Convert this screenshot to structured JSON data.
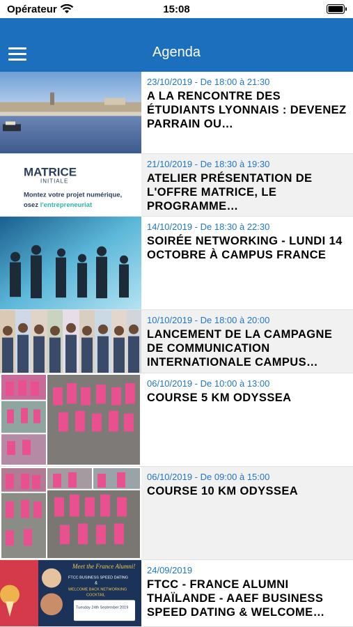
{
  "status_bar": {
    "carrier": "Opérateur",
    "time": "15:08"
  },
  "navbar": {
    "title": "Agenda",
    "menu_icon": "hamburger-icon"
  },
  "thumb_texts": {
    "matrice_logo": "MATRICE",
    "matrice_sub": "INITIALE",
    "matrice_line1": "Montez votre projet numérique,",
    "matrice_line2": "osez",
    "matrice_line2_accent": "l'entrepreneuriat",
    "ftcc_header": "Meet the France Alumni!",
    "ftcc_line1": "FTCC BUSINESS SPEED DATING",
    "ftcc_line2": "&",
    "ftcc_line3": "WELCOME BACK NETWORKING",
    "ftcc_line4": "COCKTAIL",
    "ftcc_date": "Tuesday 24th September 2019"
  },
  "events": [
    {
      "date": "23/10/2019 - De 18:00 à 21:30",
      "title": "A LA RENCONTRE DES ÉTUDIANTS LYONNAIS : DEVENEZ PARRAIN OU…"
    },
    {
      "date": "21/10/2019 - De 18:30 à 19:30",
      "title": "ATELIER PRÉSENTATION DE L'OFFRE MATRICE, LE PROGRAMME…"
    },
    {
      "date": "14/10/2019 - De 18:30 à 22:30",
      "title": "SOIRÉE NETWORKING - LUNDI 14 OCTOBRE À CAMPUS FRANCE"
    },
    {
      "date": "10/10/2019 - De 18:00 à 20:00",
      "title": "LANCEMENT DE LA CAMPAGNE DE COMMUNICATION INTERNATIONALE CAMPUS…"
    },
    {
      "date": "06/10/2019 - De 10:00 à 13:00",
      "title": "COURSE 5 KM ODYSSEA"
    },
    {
      "date": "06/10/2019 - De 09:00 à 15:00",
      "title": "COURSE 10 KM ODYSSEA"
    },
    {
      "date": "24/09/2019",
      "title": "FTCC - FRANCE ALUMNI THAÏLANDE - AAEF BUSINESS SPEED DATING & WELCOME…"
    }
  ],
  "colors": {
    "navbar": "#1b6fbd",
    "date_text": "#1f76c8",
    "alt_row": "#f1f1f1"
  }
}
